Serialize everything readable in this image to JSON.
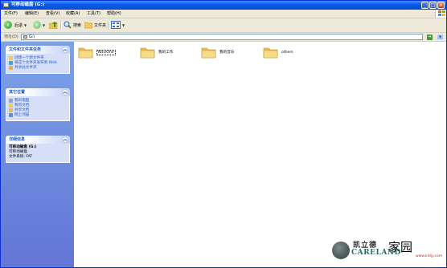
{
  "window": {
    "title": "可移动磁盘 (G:)",
    "controls": {
      "minimize": "_",
      "maximize": "□",
      "close": "×"
    }
  },
  "menubar": {
    "items": [
      "文件(F)",
      "编辑(E)",
      "查看(V)",
      "收藏(A)",
      "工具(T)",
      "帮助(H)"
    ]
  },
  "toolbar": {
    "back_label": "后退",
    "search_label": "搜索",
    "folders_label": "文件夹"
  },
  "address": {
    "label": "地址(D)",
    "value": "G:\\"
  },
  "taskpane": {
    "file_tasks": {
      "title": "文件和文件夹任务",
      "items": [
        {
          "label": "创建一个新文件夹",
          "icon": "new-folder-icon"
        },
        {
          "label": "将这个文件夹发布到 Web",
          "icon": "publish-web-icon"
        },
        {
          "label": "共享此文件夹",
          "icon": "share-folder-icon"
        }
      ]
    },
    "other_places": {
      "title": "其它位置",
      "items": [
        {
          "label": "我的电脑",
          "icon": "my-computer-icon"
        },
        {
          "label": "我的文档",
          "icon": "my-documents-icon"
        },
        {
          "label": "共享文档",
          "icon": "shared-documents-icon"
        },
        {
          "label": "网上邻居",
          "icon": "network-places-icon"
        }
      ]
    },
    "details": {
      "title": "详细信息",
      "name": "可移动磁盘 (G:)",
      "type": "可移动磁盘",
      "filesystem": "文件系统: FAT"
    }
  },
  "content": {
    "folders": [
      {
        "name": "NaviOne"
      },
      {
        "name": "我的工作"
      },
      {
        "name": "我的音乐"
      },
      {
        "name": "others"
      }
    ]
  },
  "watermark": {
    "cn_brand": "凯立德",
    "cn_home": "家园",
    "en_brand": "CARELAND",
    "url": "www.kldjy.com"
  },
  "colors": {
    "titlebar": "#0a5ee8",
    "taskpane": "#6e8ee0",
    "link": "#215dc6",
    "folder": "#f5d77a"
  }
}
